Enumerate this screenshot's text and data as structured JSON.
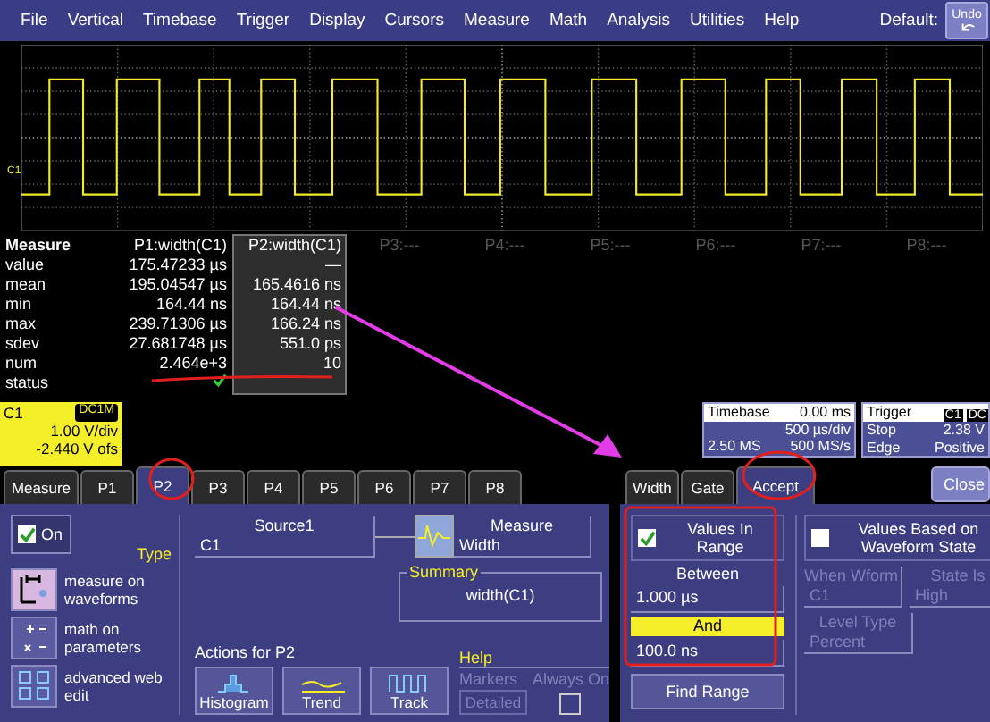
{
  "menu": {
    "items": [
      "File",
      "Vertical",
      "Timebase",
      "Trigger",
      "Display",
      "Cursors",
      "Measure",
      "Math",
      "Analysis",
      "Utilities",
      "Help"
    ],
    "default_label": "Default:",
    "undo": "Undo"
  },
  "waveform": {
    "channel_marker": "C1"
  },
  "measure_table": {
    "header": "Measure",
    "row_labels": [
      "value",
      "mean",
      "min",
      "max",
      "sdev",
      "num",
      "status"
    ],
    "columns": [
      {
        "header": "P1:width(C1)",
        "selected": false,
        "values": [
          "175.47233 µs",
          "195.04547 µs",
          "164.44 ns",
          "239.71306 µs",
          "27.681748 µs",
          "2.464e+3"
        ],
        "status_ok": true
      },
      {
        "header": "P2:width(C1)",
        "selected": true,
        "values": [
          "—",
          "165.4616 ns",
          "164.44 ns",
          "166.24 ns",
          "551.0 ps",
          "10"
        ],
        "status_ok": false
      }
    ],
    "empty_params": [
      "P3:---",
      "P4:---",
      "P5:---",
      "P6:---",
      "P7:---",
      "P8:---"
    ]
  },
  "channel": {
    "name": "C1",
    "coupling": "DC1M",
    "scale": "1.00 V/div",
    "offset": "-2.440 V ofs"
  },
  "timebase": {
    "title": "Timebase",
    "delay": "0.00 ms",
    "rate": "500 µs/div",
    "samples": "2.50 MS",
    "sample_rate": "500 MS/s"
  },
  "trigger": {
    "title": "Trigger",
    "source": "C1",
    "coupling": "DC",
    "mode": "Stop",
    "level": "2.38 V",
    "type": "Edge",
    "slope": "Positive"
  },
  "measure_tabs": [
    {
      "label": "Measure",
      "selected": false
    },
    {
      "label": "P1",
      "selected": false
    },
    {
      "label": "P2",
      "selected": true
    },
    {
      "label": "P3",
      "selected": false
    },
    {
      "label": "P4",
      "selected": false
    },
    {
      "label": "P5",
      "selected": false
    },
    {
      "label": "P6",
      "selected": false
    },
    {
      "label": "P7",
      "selected": false
    },
    {
      "label": "P8",
      "selected": false
    }
  ],
  "param_tabs": [
    {
      "label": "Width",
      "selected": false
    },
    {
      "label": "Gate",
      "selected": false
    },
    {
      "label": "Accept",
      "selected": true
    }
  ],
  "close": "Close",
  "param_panel": {
    "on": {
      "label": "On",
      "checked": true
    },
    "type_label": "Type",
    "types": [
      {
        "kind": "measure",
        "label": "measure on waveforms",
        "selected": true
      },
      {
        "kind": "math",
        "label": "math on parameters",
        "selected": false
      },
      {
        "kind": "web",
        "label": "advanced web edit",
        "selected": false
      }
    ],
    "source": {
      "label": "Source1",
      "value": "C1"
    },
    "measure": {
      "label": "Measure",
      "value": "Width"
    },
    "summary": {
      "label": "Summary",
      "value": "width(C1)"
    },
    "actions_label": "Actions for P2",
    "actions": [
      {
        "kind": "histogram",
        "label": "Histogram"
      },
      {
        "kind": "trend",
        "label": "Trend"
      },
      {
        "kind": "track",
        "label": "Track"
      }
    ],
    "help": {
      "label": "Help",
      "markers": "Markers",
      "always_on": "Always On",
      "detailed": "Detailed",
      "always_on_checked": false
    }
  },
  "accept_panel": {
    "in_range": {
      "label": "Values In Range",
      "checked": true
    },
    "between": "Between",
    "low": "1.000 µs",
    "and": "And",
    "high": "100.0 ns",
    "find_range": "Find Range",
    "wform_state": {
      "label": "Values Based on Waveform State",
      "checked": false
    },
    "when_wform": {
      "label": "When Wform",
      "value": "C1"
    },
    "state_is": {
      "label": "State Is",
      "value": "High"
    },
    "level_type": {
      "label": "Level Type",
      "value": "Percent"
    }
  }
}
